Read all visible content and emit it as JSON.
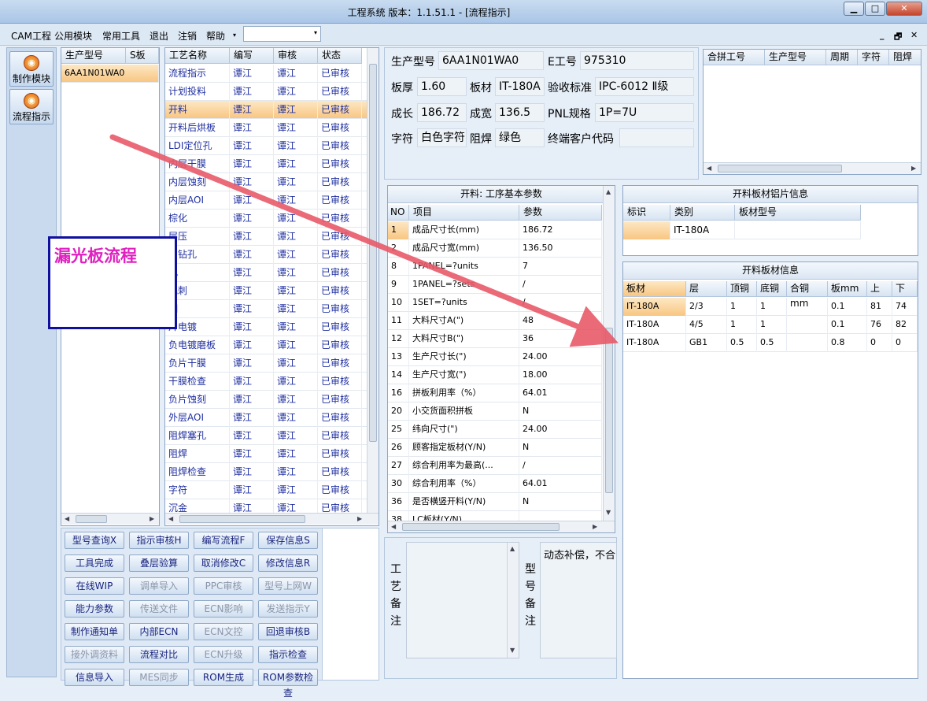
{
  "window": {
    "title": "工程系统   版本：1.1.51.1 - [流程指示]",
    "min": "▁",
    "max": "□",
    "close": "✕"
  },
  "menu": {
    "items": [
      "CAM工程",
      "公用模块",
      "常用工具",
      "退出",
      "注销",
      "帮助"
    ],
    "combo_arrow": "▾",
    "mdi": [
      "_",
      "🗗",
      "✕"
    ]
  },
  "nav": {
    "items": [
      {
        "label": "制作模块",
        "icon": "fire-icon"
      },
      {
        "label": "流程指示",
        "icon": "flow-icon"
      }
    ]
  },
  "models": {
    "headers": [
      "生产型号",
      "S板"
    ],
    "rows": [
      [
        "6AA1N01WA0",
        ""
      ]
    ]
  },
  "process": {
    "headers": [
      "工艺名称",
      "编写",
      "审核",
      "状态"
    ],
    "rows": [
      [
        "流程指示",
        "谭江",
        "谭江",
        "已审核"
      ],
      [
        "计划投料",
        "谭江",
        "谭江",
        "已审核"
      ],
      [
        "开料",
        "谭江",
        "谭江",
        "已审核"
      ],
      [
        "开料后烘板",
        "谭江",
        "谭江",
        "已审核"
      ],
      [
        "LDI定位孔",
        "谭江",
        "谭江",
        "已审核"
      ],
      [
        "内层干膜",
        "谭江",
        "谭江",
        "已审核"
      ],
      [
        "内层蚀刻",
        "谭江",
        "谭江",
        "已审核"
      ],
      [
        "内层AOI",
        "谭江",
        "谭江",
        "已审核"
      ],
      [
        "棕化",
        "谭江",
        "谭江",
        "已审核"
      ],
      [
        "层压",
        "谭江",
        "谭江",
        "已审核"
      ],
      [
        "片钻孔",
        "谭江",
        "谭江",
        "已审核"
      ],
      [
        "孔",
        "谭江",
        "谭江",
        "已审核"
      ],
      [
        "毛刺",
        "谭江",
        "谭江",
        "已审核"
      ],
      [
        "铜",
        "谭江",
        "谭江",
        "已审核"
      ],
      [
        "片电镀",
        "谭江",
        "谭江",
        "已审核"
      ],
      [
        "负电镀磨板",
        "谭江",
        "谭江",
        "已审核"
      ],
      [
        "负片干膜",
        "谭江",
        "谭江",
        "已审核"
      ],
      [
        "干膜检查",
        "谭江",
        "谭江",
        "已审核"
      ],
      [
        "负片蚀刻",
        "谭江",
        "谭江",
        "已审核"
      ],
      [
        "外层AOI",
        "谭江",
        "谭江",
        "已审核"
      ],
      [
        "阻焊塞孔",
        "谭江",
        "谭江",
        "已审核"
      ],
      [
        "阻焊",
        "谭江",
        "谭江",
        "已审核"
      ],
      [
        "阻焊检查",
        "谭江",
        "谭江",
        "已审核"
      ],
      [
        "字符",
        "谭江",
        "谭江",
        "已审核"
      ],
      [
        "沉金",
        "谭江",
        "谭江",
        "已审核"
      ]
    ]
  },
  "info": {
    "model_label": "生产型号",
    "model": "6AA1N01WA0",
    "e_label": "E工号",
    "e": "975310",
    "thick_label": "板厚",
    "thick": "1.60",
    "mat_label": "板材",
    "mat": "IT-180A",
    "std_label": "验收标准",
    "std": "IPC-6012 Ⅱ级",
    "len_label": "成长",
    "len": "186.72",
    "wid_label": "成宽",
    "wid": "136.5",
    "pnl_label": "PNL规格",
    "pnl": "1P=7U",
    "char_label": "字符",
    "char": "白色字符",
    "mask_label": "阻焊",
    "mask": "绿色",
    "cust_label": "终端客户代码",
    "cust": ""
  },
  "combine": {
    "headers": [
      "合拼工号",
      "生产型号",
      "周期",
      "字符",
      "阻焊"
    ]
  },
  "params": {
    "title": "开料: 工序基本参数",
    "headers": [
      "NO",
      "项目",
      "参数"
    ],
    "rows": [
      [
        "1",
        "成品尺寸长(mm)",
        "186.72"
      ],
      [
        "2",
        "成品尺寸宽(mm)",
        "136.50"
      ],
      [
        "8",
        "1PANEL=?units",
        "7"
      ],
      [
        "9",
        "1PANEL=?sets",
        "/"
      ],
      [
        "10",
        "1SET=?units",
        "/"
      ],
      [
        "11",
        "大料尺寸A(\")",
        "48"
      ],
      [
        "12",
        "大料尺寸B(\")",
        "36"
      ],
      [
        "13",
        "生产尺寸长(\")",
        "24.00"
      ],
      [
        "14",
        "生产尺寸宽(\")",
        "18.00"
      ],
      [
        "16",
        "拼板利用率（%）",
        "64.01"
      ],
      [
        "20",
        "小交货面积拼板",
        "N"
      ],
      [
        "25",
        "纬向尺寸(\")",
        "24.00"
      ],
      [
        "26",
        "顾客指定板材(Y/N)",
        "N"
      ],
      [
        "27",
        "综合利用率为最高(...",
        "/"
      ],
      [
        "30",
        "综合利用率（%）",
        "64.01"
      ],
      [
        "36",
        "是否横竖开料(Y/N)",
        "N"
      ],
      [
        "38",
        "LC板材(Y/N)",
        ""
      ]
    ]
  },
  "alu": {
    "title": "开料板材铝片信息",
    "headers": [
      "标识",
      "类别",
      "板材型号"
    ],
    "rows": [
      [
        "",
        "IT-180A",
        ""
      ]
    ]
  },
  "board": {
    "title": "开料板材信息",
    "headers": [
      "板材",
      "层",
      "顶铜",
      "底铜",
      "合铜mm",
      "板mm",
      "上",
      "下"
    ],
    "rows": [
      [
        "IT-180A",
        "2/3",
        "1",
        "1",
        "",
        "0.1",
        "81",
        "74"
      ],
      [
        "IT-180A",
        "4/5",
        "1",
        "1",
        "",
        "0.1",
        "76",
        "82"
      ],
      [
        "IT-180A",
        "GB1",
        "0.5",
        "0.5",
        "",
        "0.8",
        "0",
        "0"
      ]
    ]
  },
  "notes": {
    "process_label": "工艺备注",
    "model_label": "型号备注",
    "model_text": "动态补偿，不合"
  },
  "annotation": {
    "text": "漏光板流程"
  },
  "buttons": [
    [
      {
        "t": "型号查询X",
        "d": false
      },
      {
        "t": "指示审核H",
        "d": false
      },
      {
        "t": "编写流程F",
        "d": false
      },
      {
        "t": "保存信息S",
        "d": false
      }
    ],
    [
      {
        "t": "工具完成",
        "d": false
      },
      {
        "t": "叠层验算",
        "d": false
      },
      {
        "t": "取消修改C",
        "d": false
      },
      {
        "t": "修改信息R",
        "d": false
      }
    ],
    [
      {
        "t": "在线WIP",
        "d": false
      },
      {
        "t": "调单导入",
        "d": true
      },
      {
        "t": "PPC审核",
        "d": true
      },
      {
        "t": "型号上网W",
        "d": true
      }
    ],
    [
      {
        "t": "能力参数",
        "d": false
      },
      {
        "t": "传送文件",
        "d": true
      },
      {
        "t": "ECN影响",
        "d": true
      },
      {
        "t": "发送指示Y",
        "d": true
      }
    ],
    [
      {
        "t": "制作通知单",
        "d": false
      },
      {
        "t": "内部ECN",
        "d": false
      },
      {
        "t": "ECN文控",
        "d": true
      },
      {
        "t": "回退审核B",
        "d": false
      }
    ],
    [
      {
        "t": "接外调资料",
        "d": true
      },
      {
        "t": "流程对比",
        "d": false
      },
      {
        "t": "ECN升级",
        "d": true
      },
      {
        "t": "指示检查",
        "d": false
      }
    ],
    [
      {
        "t": "信息导入",
        "d": false
      },
      {
        "t": "MES同步",
        "d": true
      },
      {
        "t": "ROM生成",
        "d": false
      },
      {
        "t": "ROM参数检查",
        "d": false
      }
    ]
  ],
  "colors": {
    "accent_highlight": "#f8c682",
    "arrow": "#e85a6a",
    "annotation_text": "#e020c0",
    "annotation_border": "#1010a0"
  }
}
